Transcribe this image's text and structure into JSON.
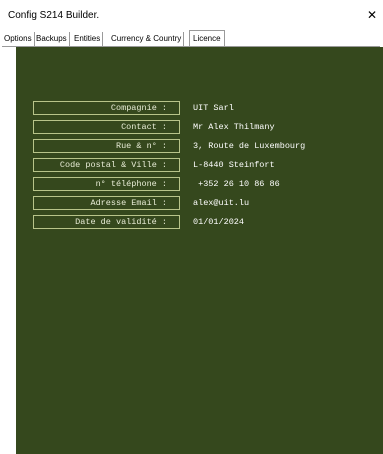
{
  "window": {
    "title": "Config S214 Builder.",
    "close_glyph": "✕"
  },
  "tabs": [
    {
      "label": "Options"
    },
    {
      "label": "Backups"
    },
    {
      "label": "Entities"
    },
    {
      "label": "Currency & Country"
    },
    {
      "label": "Licence",
      "active": true
    }
  ],
  "licence": {
    "fields": [
      {
        "label": "Compagnie :",
        "value": "UIT Sarl"
      },
      {
        "label": "Contact :",
        "value": "Mr Alex Thilmany"
      },
      {
        "label": "Rue & n° :",
        "value": "3, Route de Luxembourg"
      },
      {
        "label": "Code postal & Ville :",
        "value": "L-8440 Steinfort"
      },
      {
        "label": "n° téléphone :",
        "value": " +352 26 10 86 86"
      },
      {
        "label": "Adresse Email :",
        "value": "alex@uit.lu"
      },
      {
        "label": "Date de validité :",
        "value": "01/01/2024"
      }
    ]
  },
  "colors": {
    "panel_background": "#35481d",
    "label_border": "#b8c48a",
    "text": "#ffffff"
  }
}
